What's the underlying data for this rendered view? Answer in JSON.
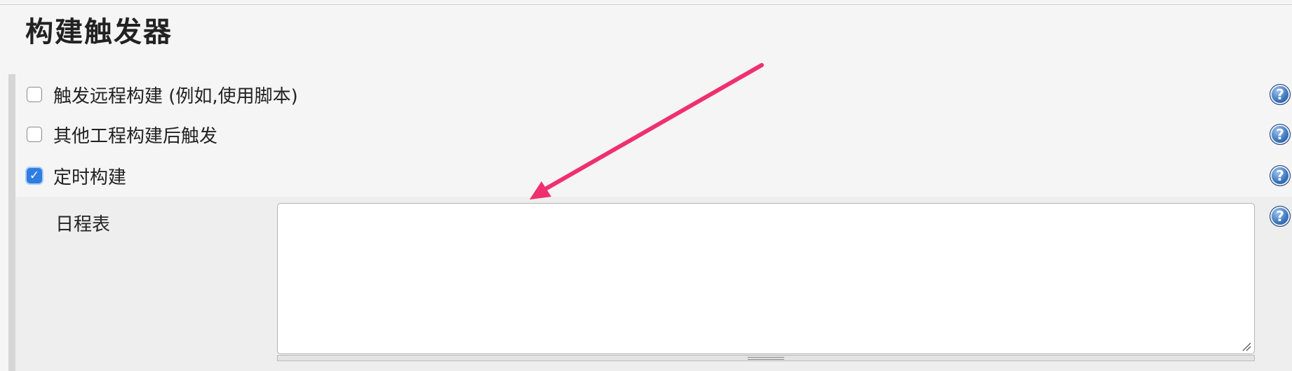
{
  "section": {
    "title": "构建触发器"
  },
  "triggers": [
    {
      "label": "触发远程构建 (例如,使用脚本)",
      "checked": false
    },
    {
      "label": "其他工程构建后触发",
      "checked": false
    },
    {
      "label": "定时构建",
      "checked": true
    }
  ],
  "schedule": {
    "label": "日程表",
    "value": ""
  },
  "icons": {
    "help": "help-icon",
    "check": "checkmark-icon",
    "arrow": "arrow-annotation"
  },
  "colors": {
    "annotation_arrow": "#f0306e",
    "checkbox_checked": "#2f7de1",
    "help_icon": "#3a73bb"
  }
}
